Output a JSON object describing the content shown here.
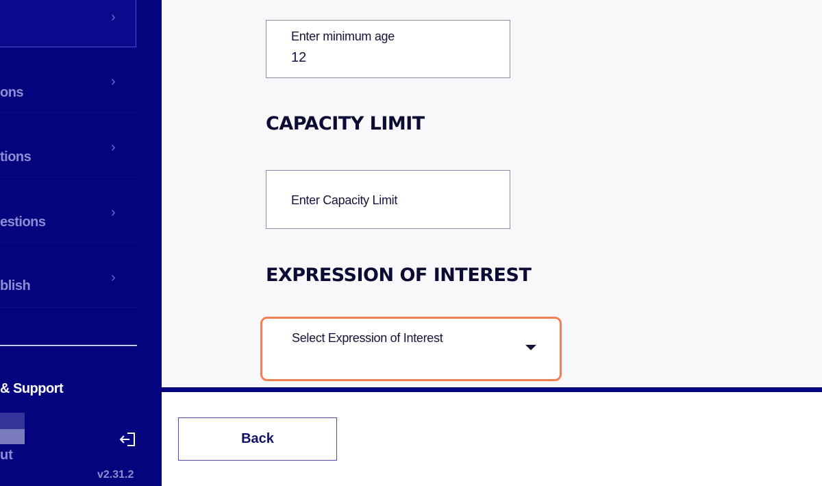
{
  "sidebar": {
    "items": [
      {
        "label": ""
      },
      {
        "label": "ons"
      },
      {
        "label": "tions"
      },
      {
        "label": "estions"
      },
      {
        "label": "blish"
      }
    ],
    "chevron_icon": "chevron-right-icon",
    "help_label": "& Support",
    "logout_label": "ut",
    "logout_icon": "logout-icon",
    "version": "v2.31.2"
  },
  "form": {
    "min_age": {
      "placeholder": "Enter minimum age",
      "value": "12"
    },
    "capacity_heading": "CAPACITY LIMIT",
    "capacity": {
      "placeholder": "Enter Capacity Limit",
      "value": ""
    },
    "eoi_heading": "EXPRESSION OF INTEREST",
    "eoi_select": {
      "placeholder": "Select Expression of Interest",
      "icon": "caret-down-icon"
    }
  },
  "footer": {
    "back_label": "Back"
  },
  "colors": {
    "sidebar_bg": "#04047f",
    "highlight": "#f37e52",
    "heading": "#0b0b33"
  }
}
